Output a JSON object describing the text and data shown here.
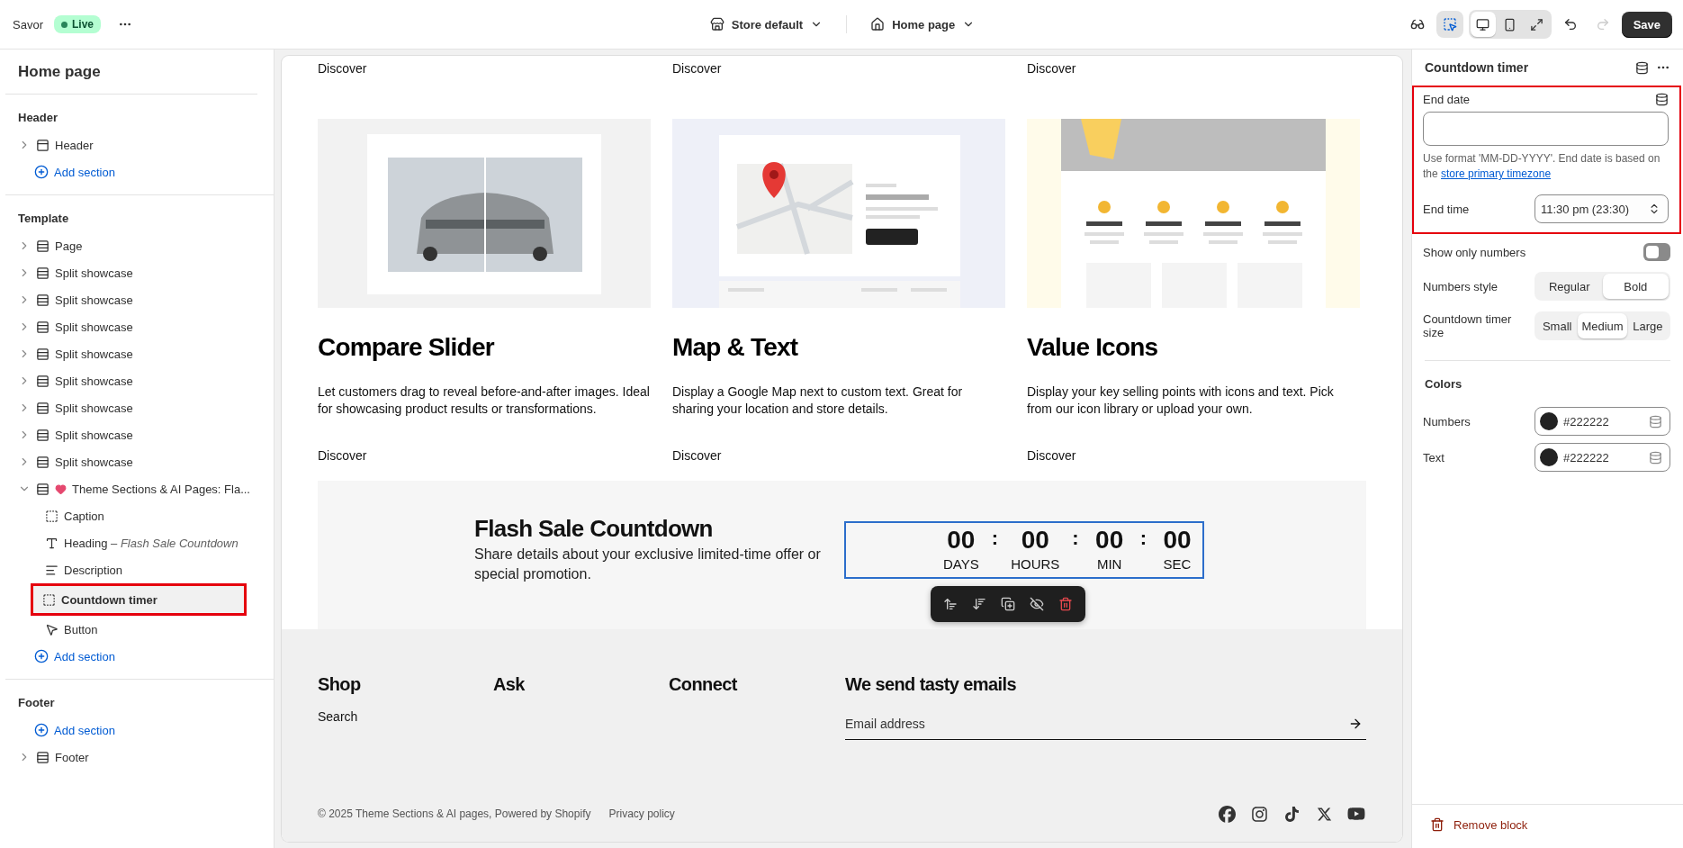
{
  "topbar": {
    "store": "Savor",
    "status": "Live",
    "theme_selector": "Store default",
    "page_selector": "Home page",
    "inspector": {
      "on": true
    },
    "views": [
      {
        "kind": "desktop",
        "selected": true
      },
      {
        "kind": "mobile",
        "selected": false
      },
      {
        "kind": "full",
        "selected": false
      }
    ],
    "redo": {
      "disabled": true
    },
    "save": "Save"
  },
  "sidebar": {
    "title": "Home page",
    "groups": [
      {
        "title": "Header",
        "items": [
          {
            "label": "Header",
            "kind": "header",
            "expanded": false,
            "selected": false
          },
          {
            "label": "Add section",
            "kind": "add"
          }
        ]
      },
      {
        "title": "Template",
        "items": [
          {
            "label": "Page",
            "kind": "section",
            "expanded": false,
            "selected": false
          },
          {
            "label": "Split showcase",
            "kind": "section",
            "expanded": false,
            "selected": false
          },
          {
            "label": "Split showcase",
            "kind": "section",
            "expanded": false,
            "selected": false
          },
          {
            "label": "Split showcase",
            "kind": "section",
            "expanded": false,
            "selected": false
          },
          {
            "label": "Split showcase",
            "kind": "section",
            "expanded": false,
            "selected": false
          },
          {
            "label": "Split showcase",
            "kind": "section",
            "expanded": false,
            "selected": false
          },
          {
            "label": "Split showcase",
            "kind": "section",
            "expanded": false,
            "selected": false
          },
          {
            "label": "Split showcase",
            "kind": "section",
            "expanded": false,
            "selected": false
          },
          {
            "label": "Split showcase",
            "kind": "section",
            "expanded": false,
            "selected": false
          },
          {
            "label": "Theme Sections & AI Pages: Fla...",
            "kind": "app-section",
            "expanded": true,
            "selected": false,
            "children": [
              {
                "label": "Caption",
                "kind": "group",
                "selected": false
              },
              {
                "label": "Heading",
                "detail": "– Flash Sale Countdown",
                "kind": "text",
                "selected": false
              },
              {
                "label": "Description",
                "kind": "paragraph",
                "selected": false
              },
              {
                "label": "Countdown timer",
                "kind": "group",
                "selected": true
              },
              {
                "label": "Button",
                "kind": "button",
                "selected": false
              }
            ]
          },
          {
            "label": "Add section",
            "kind": "add"
          }
        ]
      },
      {
        "title": "Footer",
        "items": [
          {
            "label": "Add section",
            "kind": "add"
          },
          {
            "label": "Footer",
            "kind": "section",
            "expanded": false,
            "selected": false
          }
        ]
      }
    ]
  },
  "preview": {
    "cards": [
      {
        "kind": "compare",
        "top_link": "Discover",
        "title": "Compare Slider",
        "text": "Let customers drag to reveal before-and-after images. Ideal for showcasing product results or transformations.",
        "link": "Discover"
      },
      {
        "kind": "map",
        "top_link": "Discover",
        "title": "Map & Text",
        "text": "Display a Google Map next to custom text. Great for sharing your location and store details.",
        "link": "Discover"
      },
      {
        "kind": "icons",
        "top_link": "Discover",
        "title": "Value Icons",
        "text": "Display your key selling points with icons and text. Pick from our icon library or upload your own.",
        "link": "Discover"
      }
    ],
    "countdown": {
      "title": "Flash Sale Countdown",
      "text": "Share details about your exclusive limited-time offer or special promotion.",
      "separator": ":",
      "units": [
        {
          "value": "00",
          "label": "DAYS"
        },
        {
          "value": "00",
          "label": "HOURS"
        },
        {
          "value": "00",
          "label": "MIN"
        },
        {
          "value": "00",
          "label": "SEC"
        }
      ]
    },
    "footer": {
      "columns": [
        {
          "title": "Shop",
          "links": [
            "Search"
          ]
        },
        {
          "title": "Ask"
        },
        {
          "title": "Connect"
        }
      ],
      "newsletter": {
        "title": "We send tasty emails",
        "placeholder": "Email address"
      },
      "copyright": "© 2025 Theme Sections & AI pages, Powered by Shopify",
      "privacy": "Privacy policy"
    }
  },
  "settings": {
    "title": "Countdown timer",
    "end_date": {
      "label": "End date",
      "help": "Use format 'MM-DD-YYYY'. End date is based on the ",
      "help_link": "store primary timezone"
    },
    "end_time": {
      "label": "End time",
      "value": "11:30 pm (23:30)"
    },
    "show_only_numbers": {
      "label": "Show only numbers",
      "on": false
    },
    "numbers_style": {
      "label": "Numbers style",
      "options": [
        {
          "label": "Regular",
          "selected": false
        },
        {
          "label": "Bold",
          "selected": true
        }
      ]
    },
    "size": {
      "label": "Countdown timer size",
      "options": [
        {
          "label": "Small",
          "selected": false
        },
        {
          "label": "Medium",
          "selected": true
        },
        {
          "label": "Large",
          "selected": false
        }
      ]
    },
    "colors": {
      "title": "Colors",
      "items": [
        {
          "label": "Numbers",
          "value": "#222222",
          "color": "#222222"
        },
        {
          "label": "Text",
          "value": "#222222",
          "color": "#222222"
        }
      ]
    },
    "remove": "Remove block"
  }
}
